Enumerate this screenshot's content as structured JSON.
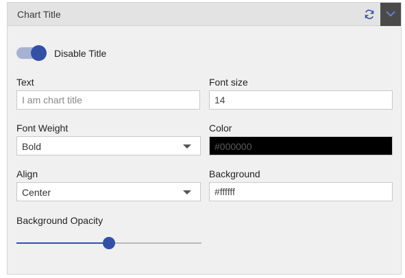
{
  "header": {
    "title": "Chart Title"
  },
  "toggle": {
    "label": "Disable Title",
    "on": true
  },
  "text": {
    "label": "Text",
    "value": "",
    "placeholder": "I am chart title"
  },
  "font_size": {
    "label": "Font size",
    "value": "14"
  },
  "font_weight": {
    "label": "Font Weight",
    "value": "Bold"
  },
  "color": {
    "label": "Color",
    "value": "#000000"
  },
  "align": {
    "label": "Align",
    "value": "Center"
  },
  "background": {
    "label": "Background",
    "value": "#ffffff"
  },
  "opacity": {
    "label": "Background Opacity",
    "value": 0.5
  },
  "colors": {
    "accent": "#3350a5"
  }
}
